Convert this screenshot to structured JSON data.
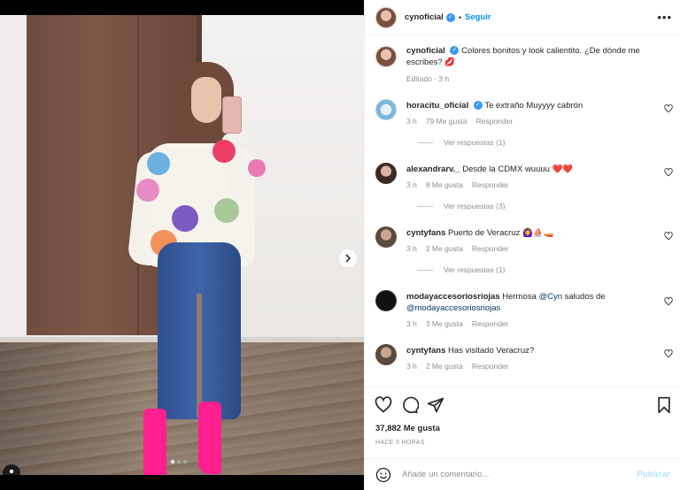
{
  "post": {
    "author": "cynoficial",
    "follow_label": "Seguir",
    "more_label": "•••"
  },
  "caption": {
    "username": "cynoficial",
    "text": "Colores bonitos y look calientito. ¿De dónde me escribes? 💋",
    "meta": "Editado · 3 h"
  },
  "comments": [
    {
      "username": "horacitu_oficial",
      "verified": true,
      "text": "Te extraño Muyyyy cabrón",
      "time": "3 h",
      "likes": "79 Me gusta",
      "reply": "Responder",
      "replies": "Ver respuestas (1)"
    },
    {
      "username": "alexandrarv._",
      "text": "Desde la CDMX wuuuu ❤️❤️",
      "time": "3 h",
      "likes": "8 Me gusta",
      "reply": "Responder",
      "replies": "Ver respuestas (3)"
    },
    {
      "username": "cyntyfans",
      "text": "Puerto de Veracruz 🙆‍♀️⛵🚤",
      "time": "3 h",
      "likes": "2 Me gusta",
      "reply": "Responder",
      "replies": "Ver respuestas (1)"
    },
    {
      "username": "modayaccesoriosriojas",
      "text_before": "Hermosa",
      "mention1": "@Cyn",
      "text_middle": "saludos de",
      "mention2": "@modayaccesoriosriojas",
      "time": "3 h",
      "likes": "3 Me gusta",
      "reply": "Responder"
    },
    {
      "username": "cyntyfans",
      "text": "Has visitado Veracruz?",
      "time": "3 h",
      "likes": "2 Me gusta",
      "reply": "Responder"
    }
  ],
  "stats": {
    "likes": "37,882 Me gusta",
    "time_ago": "HACE 3 HORAS"
  },
  "composer": {
    "placeholder": "Añade un comentario...",
    "publish_label": "Publicar"
  },
  "carousel": {
    "current": 1,
    "total": 3
  },
  "colors": {
    "link": "#0095f6",
    "verified": "#3897f0",
    "muted": "#8e8e8e",
    "boots": "#ff1f8e"
  }
}
